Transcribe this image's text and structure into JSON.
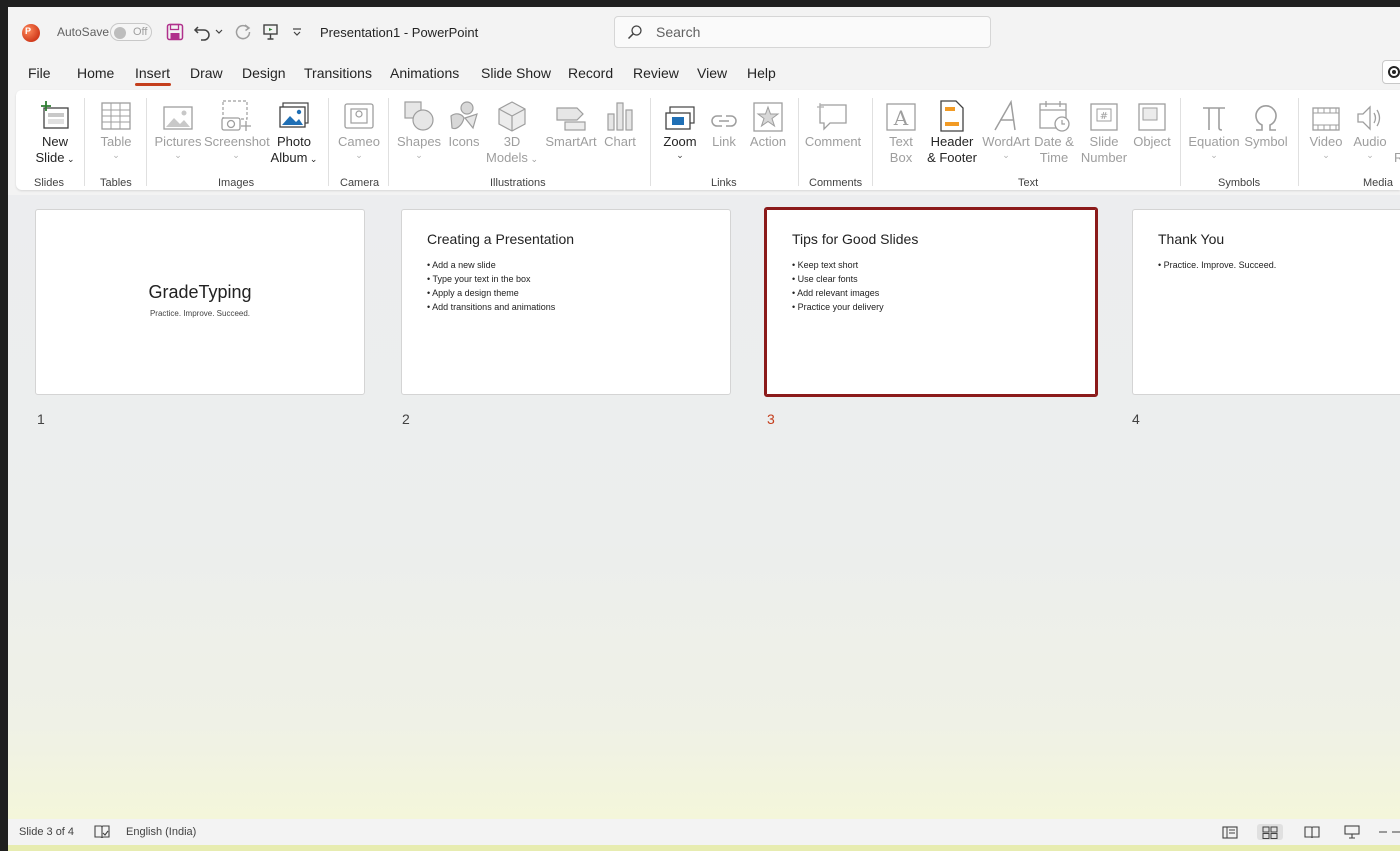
{
  "titlebar": {
    "autosave_label": "AutoSave",
    "autosave_state": "Off",
    "doc_title": "Presentation1  -  PowerPoint",
    "search_placeholder": "Search"
  },
  "tabs": [
    "File",
    "Home",
    "Insert",
    "Draw",
    "Design",
    "Transitions",
    "Animations",
    "Slide Show",
    "Record",
    "Review",
    "View",
    "Help"
  ],
  "active_tab": "Insert",
  "ribbon": {
    "new_slide": [
      "New",
      "Slide"
    ],
    "table": "Table",
    "pictures": "Pictures",
    "screenshot": "Screenshot",
    "photo_album": [
      "Photo",
      "Album"
    ],
    "cameo": "Cameo",
    "shapes": "Shapes",
    "icons": "Icons",
    "models_3d": [
      "3D",
      "Models"
    ],
    "smartart": "SmartArt",
    "chart": "Chart",
    "zoom": "Zoom",
    "link": "Link",
    "action": "Action",
    "comment": "Comment",
    "text_box": [
      "Text",
      "Box"
    ],
    "header_footer": [
      "Header",
      "& Footer"
    ],
    "wordart": "WordArt",
    "date_time": [
      "Date &",
      "Time"
    ],
    "slide_number": [
      "Slide",
      "Number"
    ],
    "object": "Object",
    "equation": "Equation",
    "symbol": "Symbol",
    "video": "Video",
    "audio": "Audio",
    "screen_rec_partial": "Re",
    "groups": {
      "slides": "Slides",
      "tables": "Tables",
      "images": "Images",
      "camera": "Camera",
      "illustrations": "Illustrations",
      "links": "Links",
      "comments": "Comments",
      "text": "Text",
      "symbols": "Symbols",
      "media": "Media"
    }
  },
  "slides": [
    {
      "num": "1",
      "title": "GradeTyping",
      "subtitle": "Practice. Improve. Succeed."
    },
    {
      "num": "2",
      "title": "Creating a Presentation",
      "bullets": [
        "• Add a new slide",
        "• Type your text in the box",
        "• Apply a design theme",
        "• Add transitions and animations"
      ]
    },
    {
      "num": "3",
      "title": "Tips for Good Slides",
      "bullets": [
        "• Keep text short",
        "• Use clear fonts",
        "• Add relevant images",
        "• Practice your delivery"
      ]
    },
    {
      "num": "4",
      "title": "Thank You",
      "bullets": [
        "• Practice. Improve. Succeed."
      ]
    }
  ],
  "selected_slide": 3,
  "status": {
    "slide_info": "Slide 3 of 4",
    "language": "English (India)"
  },
  "colors": {
    "accent": "#c43e1c",
    "selected_border": "#8b1a1a"
  }
}
